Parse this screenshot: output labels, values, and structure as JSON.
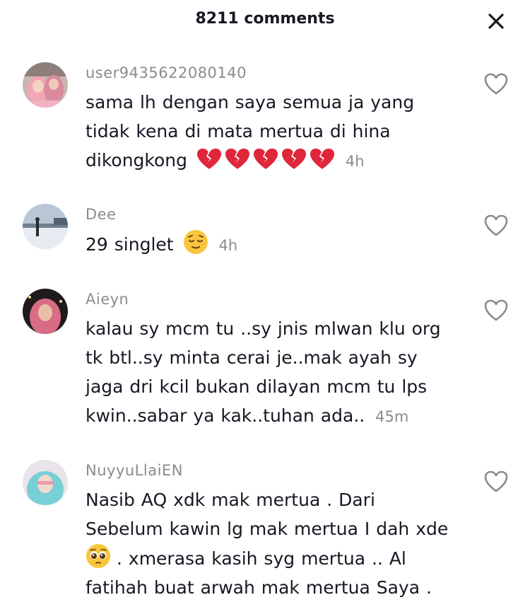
{
  "header": {
    "title": "8211 comments",
    "close_icon": "close-icon"
  },
  "comments": [
    {
      "username": "user9435622080140",
      "text_lines": [
        "sama lh dengan saya semua ja yang",
        "tidak kena di mata mertua di hina",
        "dikongkong"
      ],
      "emojis": [
        "broken-heart",
        "broken-heart",
        "broken-heart",
        "broken-heart",
        "broken-heart"
      ],
      "time": "4h",
      "avatar": "avatar-two-women-pink-hijab"
    },
    {
      "username": "Dee",
      "text_lines": [
        "29 singlet"
      ],
      "emojis": [
        "relieved-face"
      ],
      "time": "4h",
      "avatar": "avatar-person-at-lake"
    },
    {
      "username": "Aieyn",
      "text_lines": [
        "kalau sy mcm tu ..sy jnis mlwan klu org",
        "tk btl..sy minta cerai je..mak ayah sy",
        "jaga dri kcil bukan dilayan mcm tu lps",
        "kwin..sabar ya kak..tuhan ada.."
      ],
      "time": "45m",
      "avatar": "avatar-woman-pink-hijab-dark"
    },
    {
      "username": "NuyyuLlaiEN",
      "text_lines": [
        "Nasib AQ xdk mak mertua . Dari",
        "Sebelum kawin lg mak mertua I dah xde",
        ". xmerasa kasih syg mertua .. Al",
        "fatihah buat arwah mak mertua Saya ."
      ],
      "emojis": [
        "pleading-face"
      ],
      "avatar": "avatar-woman-teal-hijab"
    }
  ],
  "colors": {
    "text": "#161823",
    "secondary": "#8a8b91",
    "heart_outline": "#8a8b91",
    "broken_heart": "#e0263b"
  }
}
